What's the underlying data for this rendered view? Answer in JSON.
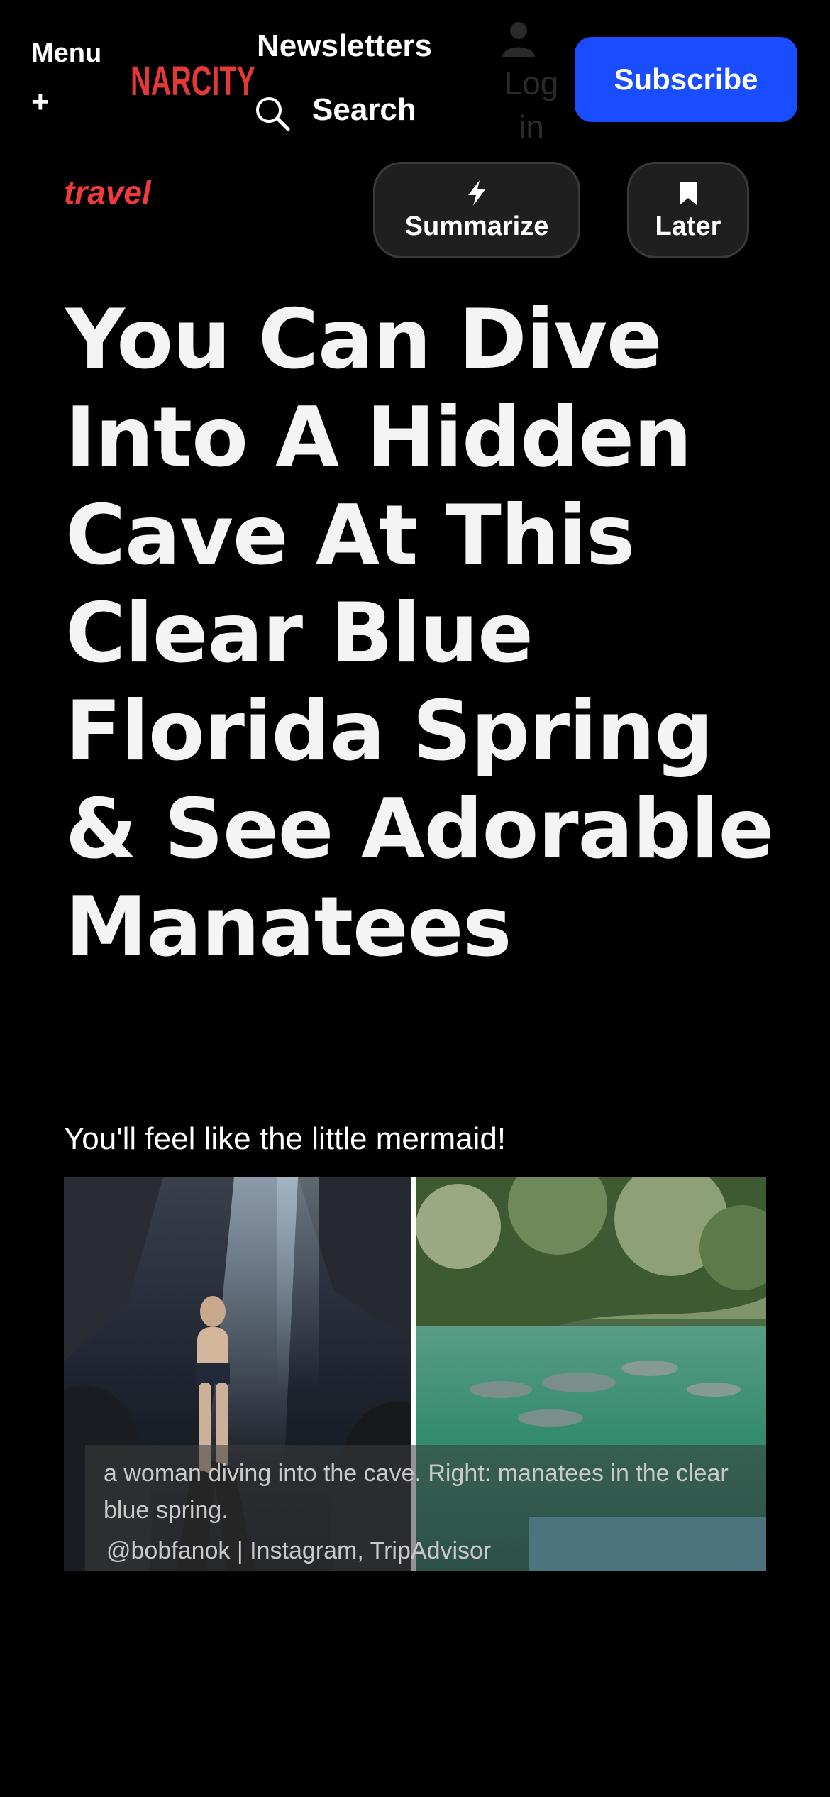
{
  "header": {
    "menu_label": "Menu",
    "menu_plus": "+",
    "logo_text": "NARCITY",
    "newsletters_label": "Newsletters",
    "search_label": "Search",
    "login_label": "Log in",
    "subscribe_label": "Subscribe"
  },
  "section": {
    "tag": "travel"
  },
  "actions": {
    "summarize_label": "Summarize",
    "later_label": "Later"
  },
  "article": {
    "headline": "You Can Dive Into A Hidden Cave At This Clear Blue Florida Spring & See Adorable Manatees",
    "subtitle": "You'll feel like the little mermaid!",
    "image_caption": "a woman diving into the cave. Right: manatees in the clear blue spring.",
    "image_credit": "@bobfanok | Instagram, TripAdvisor"
  },
  "colors": {
    "accent_blue": "#1a4dff",
    "brand_red": "#ef3b3b",
    "background": "#000000"
  },
  "icons": [
    "menu-plus-icon",
    "search-icon",
    "user-icon",
    "bolt-icon",
    "bookmark-icon"
  ]
}
